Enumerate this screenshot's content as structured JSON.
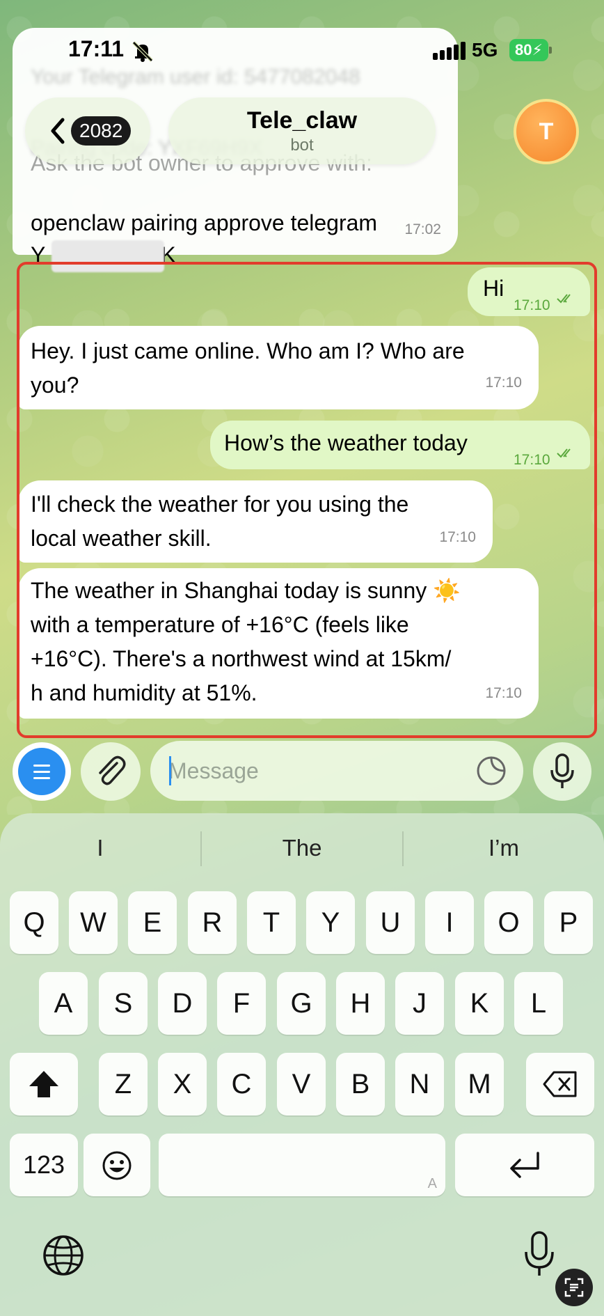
{
  "status_bar": {
    "time": "17:11",
    "network": "5G",
    "battery": "80"
  },
  "header": {
    "back_count": "2082",
    "title": "Tele_claw",
    "subtitle": "bot",
    "avatar_letter": "T"
  },
  "previous_message": {
    "blurred_lines": [
      "Your Telegram user id: 5477082048",
      "Pairing code: YXF69H9X"
    ],
    "line1": "Ask the bot owner to approve with:",
    "line2": "openclaw pairing approve telegram",
    "line3_suffix": "K",
    "line3_prefix": "Y",
    "time": "17:02"
  },
  "messages": [
    {
      "direction": "out",
      "text": "Hi",
      "time": "17:10"
    },
    {
      "direction": "in",
      "lines": [
        "Hey. I just came online. Who am I? Who are",
        "you?"
      ],
      "time": "17:10"
    },
    {
      "direction": "out",
      "text": "How’s the weather today",
      "time": "17:10"
    },
    {
      "direction": "in",
      "lines": [
        "I'll check the weather for you using the",
        "local weather skill."
      ],
      "time": "17:10"
    },
    {
      "direction": "in",
      "lines": [
        "The weather in Shanghai today is sunny ☀️",
        "with a temperature of +16°C (feels like",
        "+16°C). There's a northwest wind at 15km/",
        "h and humidity at 51%."
      ],
      "time": "17:10"
    }
  ],
  "input": {
    "placeholder": "Message"
  },
  "keyboard": {
    "suggestions": [
      "I",
      "The",
      "I’m"
    ],
    "row1": [
      "Q",
      "W",
      "E",
      "R",
      "T",
      "Y",
      "U",
      "I",
      "O",
      "P"
    ],
    "row2": [
      "A",
      "S",
      "D",
      "F",
      "G",
      "H",
      "J",
      "K",
      "L"
    ],
    "row3": [
      "Z",
      "X",
      "C",
      "V",
      "B",
      "N",
      "M"
    ],
    "numbers_key": "123",
    "space_hint": "A"
  },
  "icons": {
    "back": "chevron-left-icon",
    "mute": "bell-slash-icon",
    "menu": "menu-icon",
    "attach": "paperclip-icon",
    "sticker": "sticker-icon",
    "mic": "microphone-icon",
    "shift": "shift-icon",
    "delete": "backspace-icon",
    "emoji": "emoji-icon",
    "return": "return-icon",
    "globe": "globe-icon",
    "dictation": "microphone-icon"
  },
  "colors": {
    "accent": "#2a8ff0",
    "outgoing_bubble": "#e1f7c6",
    "highlight": "#e23c2c",
    "battery": "#34c759"
  }
}
